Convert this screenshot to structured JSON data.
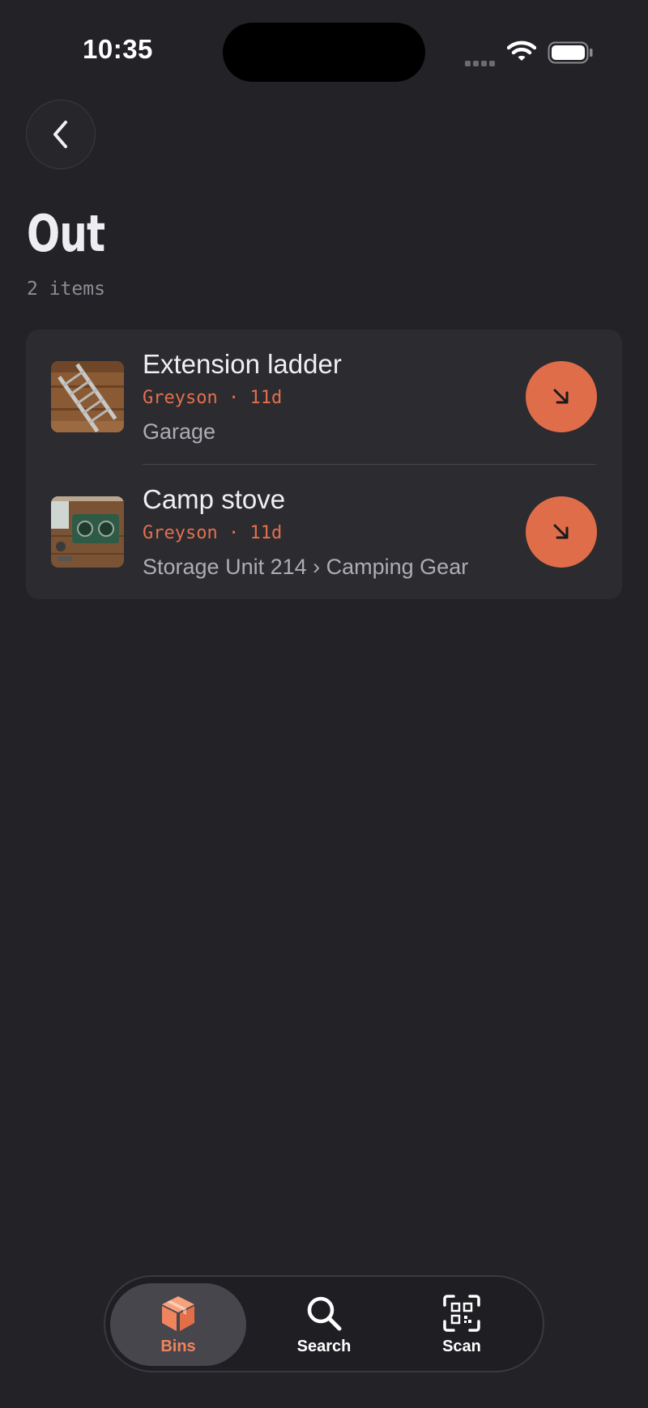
{
  "status_bar": {
    "time": "10:35"
  },
  "header": {
    "back_icon": "chevron-left-icon",
    "title": "Out",
    "item_count": "2 items"
  },
  "items": [
    {
      "name": "Extension ladder",
      "meta": "Greyson · 11d",
      "location": "Garage",
      "thumbnail": "ladder-photo",
      "action_icon": "arrow-down-right-icon"
    },
    {
      "name": "Camp stove",
      "meta": "Greyson · 11d",
      "location": "Storage Unit 214 › Camping Gear",
      "thumbnail": "camp-stove-photo",
      "action_icon": "arrow-down-right-icon"
    }
  ],
  "tab_bar": {
    "tabs": [
      {
        "label": "Bins",
        "icon": "box-icon",
        "active": true
      },
      {
        "label": "Search",
        "icon": "search-icon",
        "active": false
      },
      {
        "label": "Scan",
        "icon": "qr-scan-icon",
        "active": false
      }
    ]
  },
  "colors": {
    "background": "#232227",
    "card": "#2c2b30",
    "accent": "#e06d4a",
    "accent_text": "#e3704d",
    "active_tab_label": "#f0845d"
  }
}
